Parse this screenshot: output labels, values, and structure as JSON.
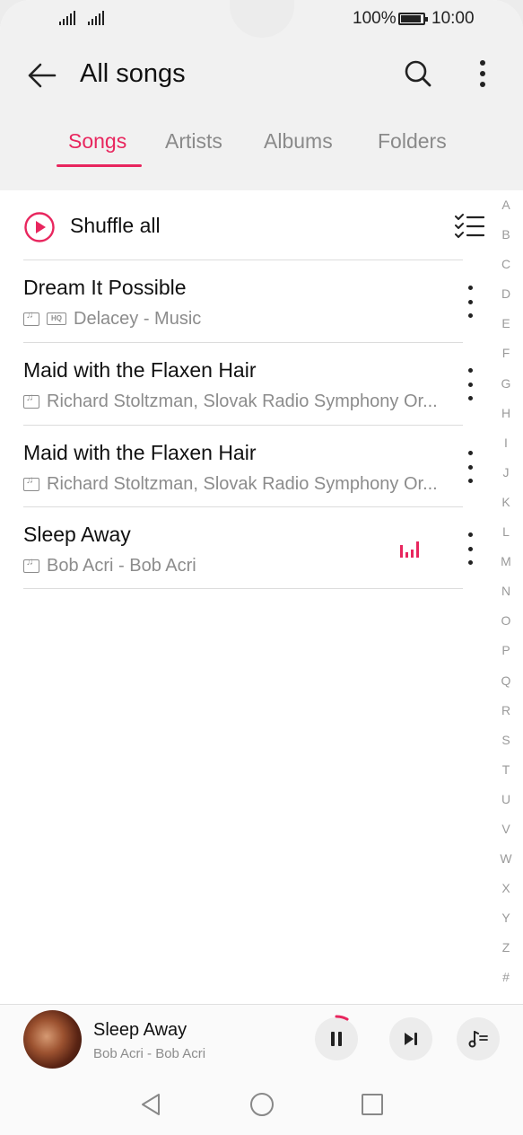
{
  "status_bar": {
    "battery": "100%",
    "time": "10:00"
  },
  "header": {
    "title": "All songs",
    "back_icon": "arrow-left-icon",
    "search_icon": "search-icon",
    "more_icon": "more-vertical-icon"
  },
  "tabs": [
    {
      "label": "Songs",
      "active": true
    },
    {
      "label": "Artists",
      "active": false
    },
    {
      "label": "Albums",
      "active": false
    },
    {
      "label": "Folders",
      "active": false
    }
  ],
  "shuffle": {
    "label": "Shuffle all",
    "icon": "play-circle-icon",
    "multiselect_icon": "checklist-icon"
  },
  "songs": [
    {
      "title": "Dream It Possible",
      "subtitle": "Delacey - Music",
      "hq": true,
      "playing": false
    },
    {
      "title": "Maid with the Flaxen Hair",
      "subtitle": "Richard Stoltzman, Slovak Radio Symphony Or...",
      "hq": false,
      "playing": false
    },
    {
      "title": "Maid with the Flaxen Hair",
      "subtitle": "Richard Stoltzman, Slovak Radio Symphony Or...",
      "hq": false,
      "playing": false
    },
    {
      "title": "Sleep Away",
      "subtitle": "Bob Acri - Bob Acri",
      "hq": false,
      "playing": true
    }
  ],
  "hq_label": "HQ",
  "alphabet": [
    "A",
    "B",
    "C",
    "D",
    "E",
    "F",
    "G",
    "H",
    "I",
    "J",
    "K",
    "L",
    "M",
    "N",
    "O",
    "P",
    "Q",
    "R",
    "S",
    "T",
    "U",
    "V",
    "W",
    "X",
    "Y",
    "Z",
    "#"
  ],
  "now_playing": {
    "title": "Sleep Away",
    "subtitle": "Bob Acri - Bob Acri",
    "progress": 0.08
  },
  "colors": {
    "accent": "#e8265e"
  }
}
